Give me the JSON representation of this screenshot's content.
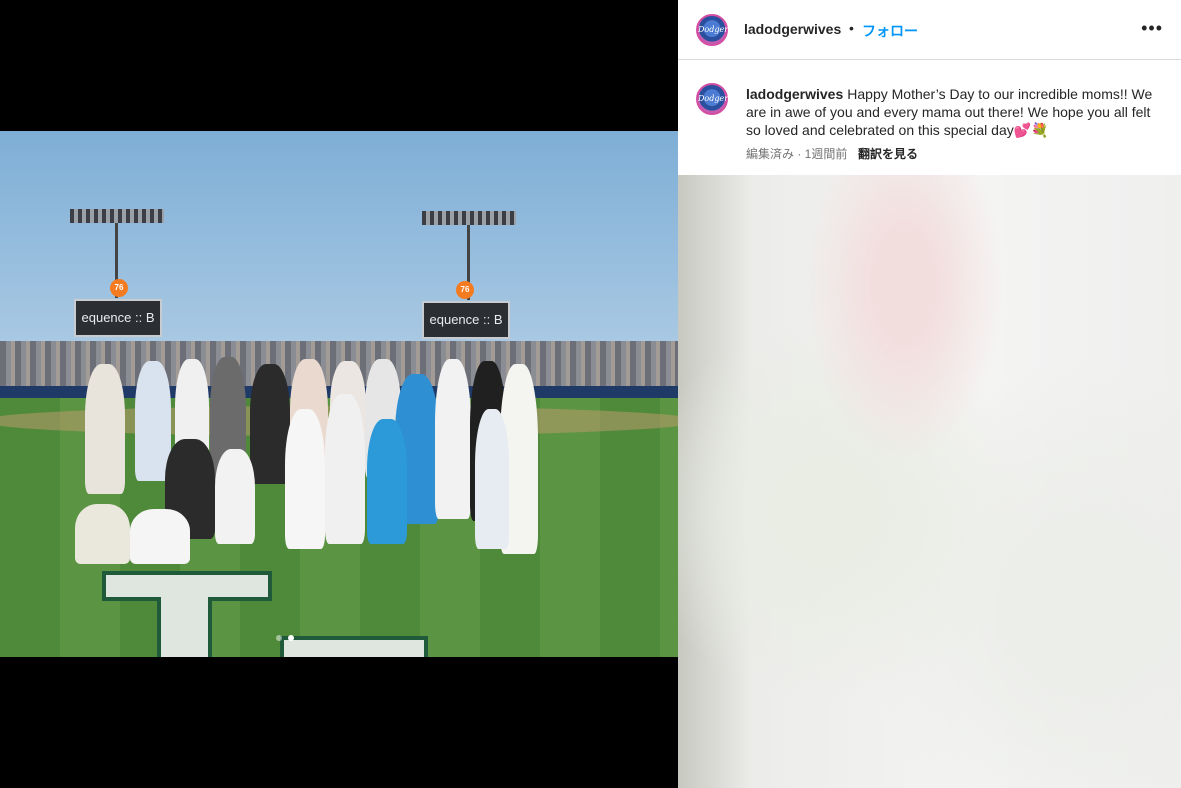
{
  "post": {
    "username": "ladodgerwives",
    "separator": "•",
    "follow_label": "フォロー",
    "more_label": "•••",
    "avatar_text": "Dodgers"
  },
  "caption": {
    "username": "ladodgerwives",
    "text": "Happy Mother’s Day to our incredible moms!! We are in awe of you and every mama out there! We hope you all felt so loved and celebrated on this special day💕💐",
    "meta": "編集済み · 1週間前",
    "translate_label": "翻訳を見る"
  },
  "photo": {
    "scoreboard_left": "equence :: B",
    "scoreboard_right": "equence :: B",
    "badge": "76",
    "carousel": {
      "count": 2,
      "active_index": 1
    }
  }
}
